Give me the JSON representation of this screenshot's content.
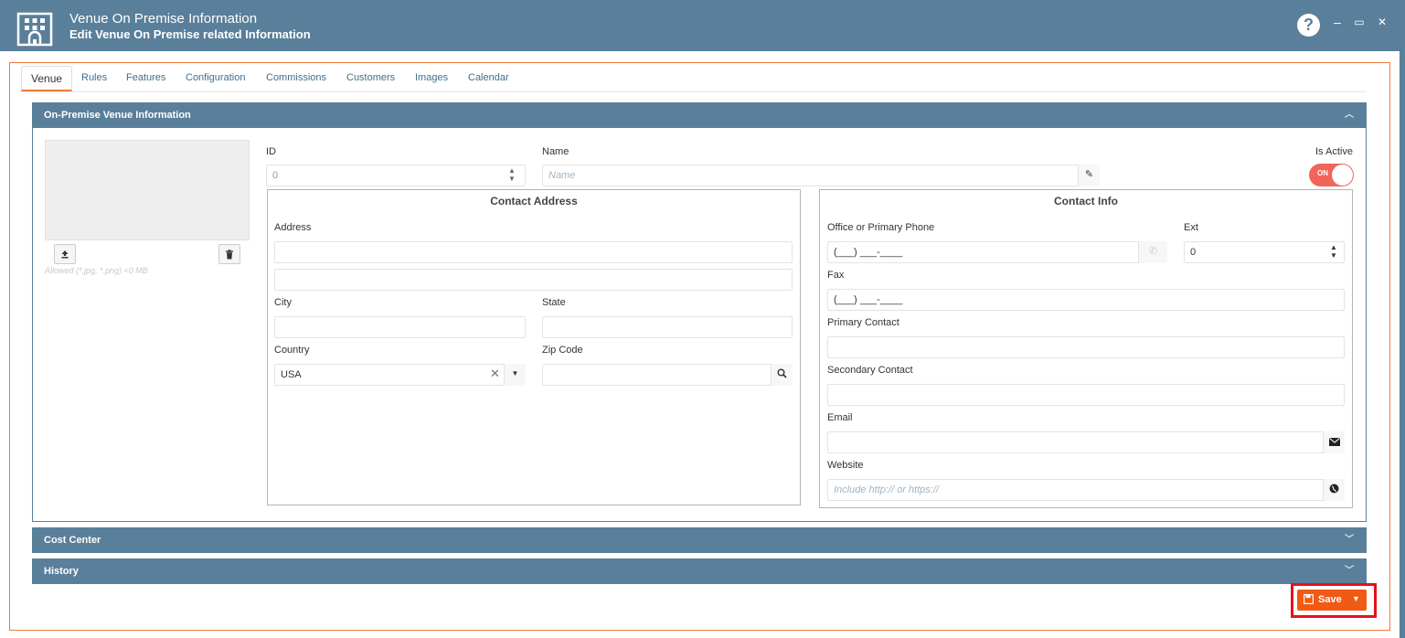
{
  "header": {
    "title": "Venue On Premise Information",
    "subtitle": "Edit Venue On Premise related Information",
    "help_label": "?",
    "minimize_label": "–",
    "maximize_label": "▭",
    "close_label": "✕"
  },
  "tabs": [
    {
      "label": "Venue",
      "active": true
    },
    {
      "label": "Rules"
    },
    {
      "label": "Features"
    },
    {
      "label": "Configuration"
    },
    {
      "label": "Commissions"
    },
    {
      "label": "Customers"
    },
    {
      "label": "Images"
    },
    {
      "label": "Calendar"
    }
  ],
  "venue_section": {
    "title": "On-Premise Venue Information",
    "image_allowed_text": "Allowed (*.jpg, *.png) <0 MB",
    "id_label": "ID",
    "id_value": "0",
    "name_label": "Name",
    "name_placeholder": "Name",
    "is_active_label": "Is Active",
    "is_active_value": "ON"
  },
  "contact_address": {
    "legend": "Contact Address",
    "address_label": "Address",
    "city_label": "City",
    "state_label": "State",
    "country_label": "Country",
    "country_value": "USA",
    "zip_label": "Zip Code"
  },
  "contact_info": {
    "legend": "Contact Info",
    "phone_label": "Office or Primary Phone",
    "phone_value": "(___) ___-____",
    "ext_label": "Ext",
    "ext_value": "0",
    "fax_label": "Fax",
    "fax_value": "(___) ___-____",
    "primary_contact_label": "Primary Contact",
    "secondary_contact_label": "Secondary Contact",
    "email_label": "Email",
    "website_label": "Website",
    "website_placeholder": "Include http:// or https://"
  },
  "sections": {
    "cost_center": "Cost Center",
    "history": "History"
  },
  "footer": {
    "save_label": "Save"
  },
  "colors": {
    "header_bg": "#5a7f9a",
    "accent": "#ee7b3c",
    "save_bg": "#f05a14",
    "toggle_on": "#f2645a"
  }
}
